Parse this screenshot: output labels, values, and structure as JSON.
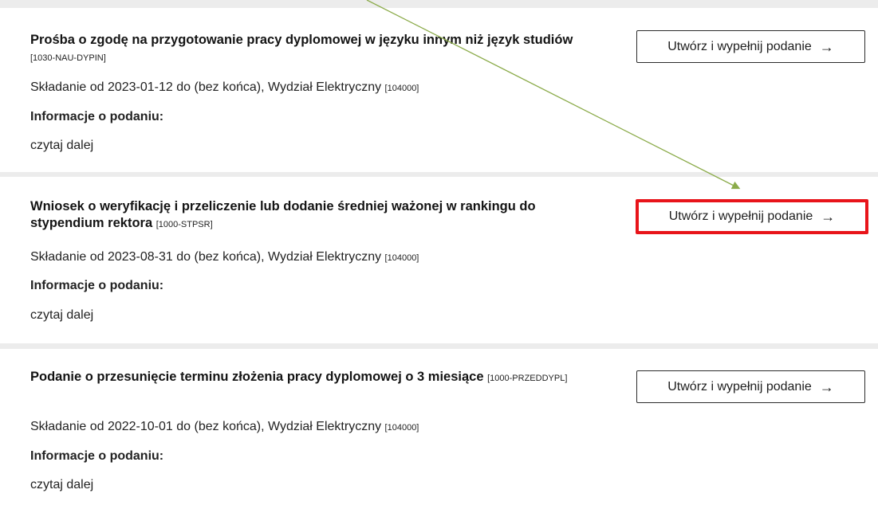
{
  "cards": [
    {
      "title": "Prośba o zgodę na przygotowanie pracy dyplomowej w języku innym niż język studiów",
      "code": "[1030-NAU-DYPIN]",
      "submission": "Składanie od 2023-01-12 do (bez końca), Wydział Elektryczny",
      "dept_code": "[104000]",
      "info_label": "Informacje o podaniu:",
      "read_more": "czytaj dalej",
      "button_label": "Utwórz i wypełnij podanie",
      "button_icon": "arrow-right-icon",
      "highlighted": false
    },
    {
      "title": "Wniosek o weryfikację i przeliczenie lub dodanie średniej ważonej w rankingu do stypendium rektora",
      "code": "[1000-STPSR]",
      "submission": "Składanie od 2023-08-31 do (bez końca), Wydział Elektryczny",
      "dept_code": "[104000]",
      "info_label": "Informacje o podaniu:",
      "read_more": "czytaj dalej",
      "button_label": "Utwórz i wypełnij podanie",
      "button_icon": "arrow-right-icon",
      "highlighted": true
    },
    {
      "title": "Podanie o przesunięcie terminu złożenia pracy dyplomowej o 3 miesiące",
      "code": "[1000-PRZEDDYPL]",
      "submission": "Składanie od 2022-10-01 do (bez końca), Wydział Elektryczny",
      "dept_code": "[104000]",
      "info_label": "Informacje o podaniu:",
      "read_more": "czytaj dalej",
      "button_label": "Utwórz i wypełnij podanie",
      "button_icon": "arrow-right-icon",
      "highlighted": false
    }
  ],
  "annotation": {
    "arrow_color": "#8bab4a",
    "highlight_color": "#e8141a"
  },
  "arrow_glyph": "→"
}
